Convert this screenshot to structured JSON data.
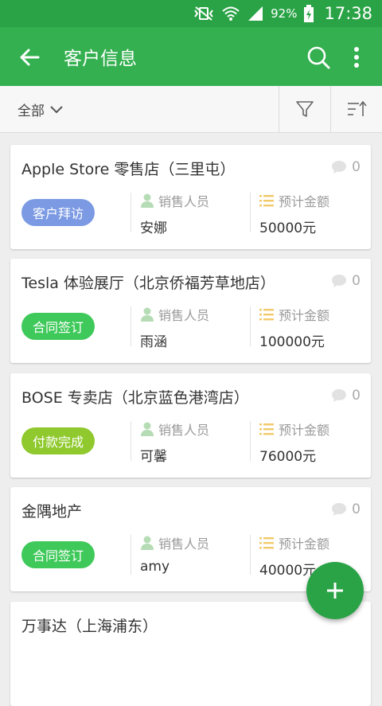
{
  "status": {
    "battery": "92%",
    "time": "17:38"
  },
  "appbar": {
    "title": "客户信息"
  },
  "filter": {
    "all_label": "全部"
  },
  "labels": {
    "sales": "销售人员",
    "amount": "预计金额"
  },
  "colors": {
    "primary": "#34b050",
    "tag_visit": "#7b9ae3",
    "tag_contract": "#3ec95a",
    "tag_paid": "#8fc92d",
    "icon_accent": "#f2c96a"
  },
  "customers": [
    {
      "name": "Apple Store 零售店（三里屯）",
      "comments": "0",
      "tag": "客户拜访",
      "tag_color": "#7b9ae3",
      "sales": "安娜",
      "amount": "50000元"
    },
    {
      "name": "Tesla 体验展厅（北京侨福芳草地店）",
      "comments": "0",
      "tag": "合同签订",
      "tag_color": "#3ec95a",
      "sales": "雨涵",
      "amount": "100000元"
    },
    {
      "name": "BOSE 专卖店（北京蓝色港湾店）",
      "comments": "0",
      "tag": "付款完成",
      "tag_color": "#8fc92d",
      "sales": "可馨",
      "amount": "76000元"
    },
    {
      "name": "金隅地产",
      "comments": "0",
      "tag": "合同签订",
      "tag_color": "#3ec95a",
      "sales": "amy",
      "amount": "40000元"
    },
    {
      "name": "万事达（上海浦东）"
    }
  ]
}
